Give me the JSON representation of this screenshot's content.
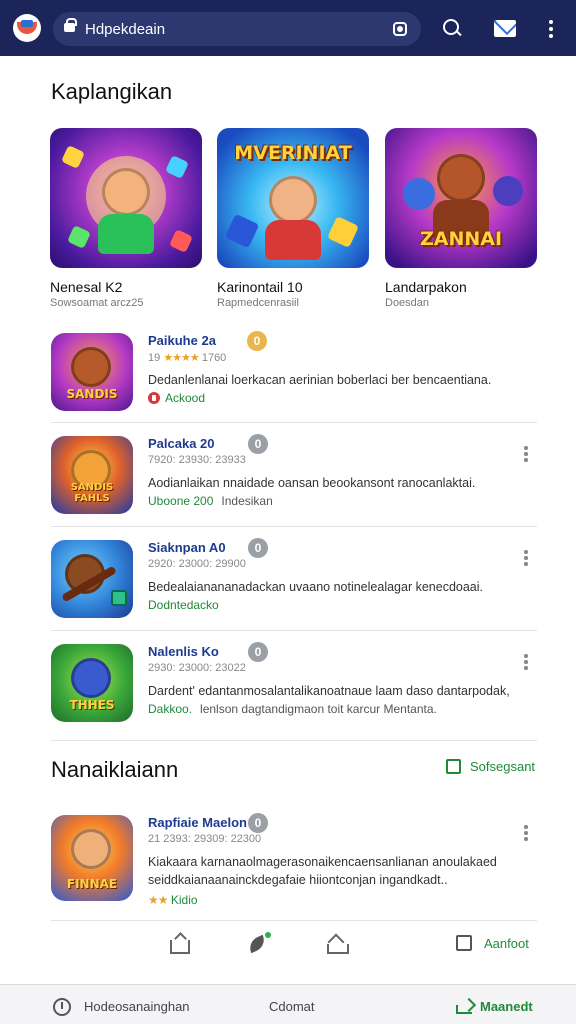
{
  "topbar": {
    "search_text": "Hdpekdeain",
    "brand_color": "#1b2559",
    "icons": [
      "logo-icon",
      "lock-icon",
      "camera-icon",
      "search-icon",
      "mail-icon",
      "more-vertical-icon"
    ]
  },
  "section1": {
    "heading": "Kaplangikan",
    "featured": [
      {
        "banner": "",
        "title": "Nenesal K2",
        "subtitle": "Sowsoamat arcz25"
      },
      {
        "banner": "MVERINIAT",
        "title": "Karinontail 10",
        "subtitle": "Rapmedcenrasiil"
      },
      {
        "banner": "ZANNAI",
        "title": "Landarpakon",
        "subtitle": "Doesdan"
      }
    ]
  },
  "items": [
    {
      "title": "Paikuhe 2a",
      "badge": "0",
      "rating": "19",
      "stars": "★★★★",
      "meta": "1760",
      "desc": "Dedanlenlanai loerkacan aerinian boberlaci ber bencaentiana.",
      "tag": "Ackood",
      "tag_extra": "",
      "icon_word": "SANDIS"
    },
    {
      "title": "Palcaka 20",
      "badge": "0",
      "meta": "7920: 23930: 23933",
      "desc": "Aodianlaikan nnaidade oansan beookansont ranocanlaktai.",
      "tag": "Uboone 200",
      "tag_extra": "Indesikan",
      "icon_word": "SANDIS FAHLS"
    },
    {
      "title": "Siaknpan A0",
      "badge": "0",
      "meta": "2920: 23000: 29900",
      "desc": "Bedealaianananadackan uvaano notinelealagar kenecdoaai.",
      "tag": "Dodntedacko",
      "tag_extra": "",
      "icon_word": ""
    },
    {
      "title": "Nalenlis Ko",
      "badge": "0",
      "meta": "2930: 23000: 23022",
      "desc": "Dardent' edantanmosalantalikanoatnaue laam daso dantarpodak,",
      "tag": "Dakkoo.",
      "tag_extra": "lenlson dagtandigmaon toit karcur Mentanta.",
      "icon_word": "THHES"
    }
  ],
  "section2": {
    "heading": "Nanaiklaiann",
    "see_all": "Sofsegsant",
    "item": {
      "title": "Rapfiaie Maelon",
      "badge": "0",
      "meta": "21 2393: 29309: 22300",
      "desc_line1": "Kiakaara karnanaolmagerasonaikencaensanlianan anoulakaed",
      "desc_line2": "seiddkaianaanainckdegafaie hiiontconjan  ingandkadt..",
      "stars": "★★",
      "tag": "Kidio",
      "icon_word": "FINNAE"
    }
  },
  "actions": {
    "right_label": "Aanfoot"
  },
  "bottomnav": {
    "left": "Hodeosanainghan",
    "center": "Cdomat",
    "right": "Maanedt"
  },
  "colors": {
    "accent_green": "#1f8a3a",
    "title_blue": "#1f3b8f",
    "star": "#e9a323"
  }
}
